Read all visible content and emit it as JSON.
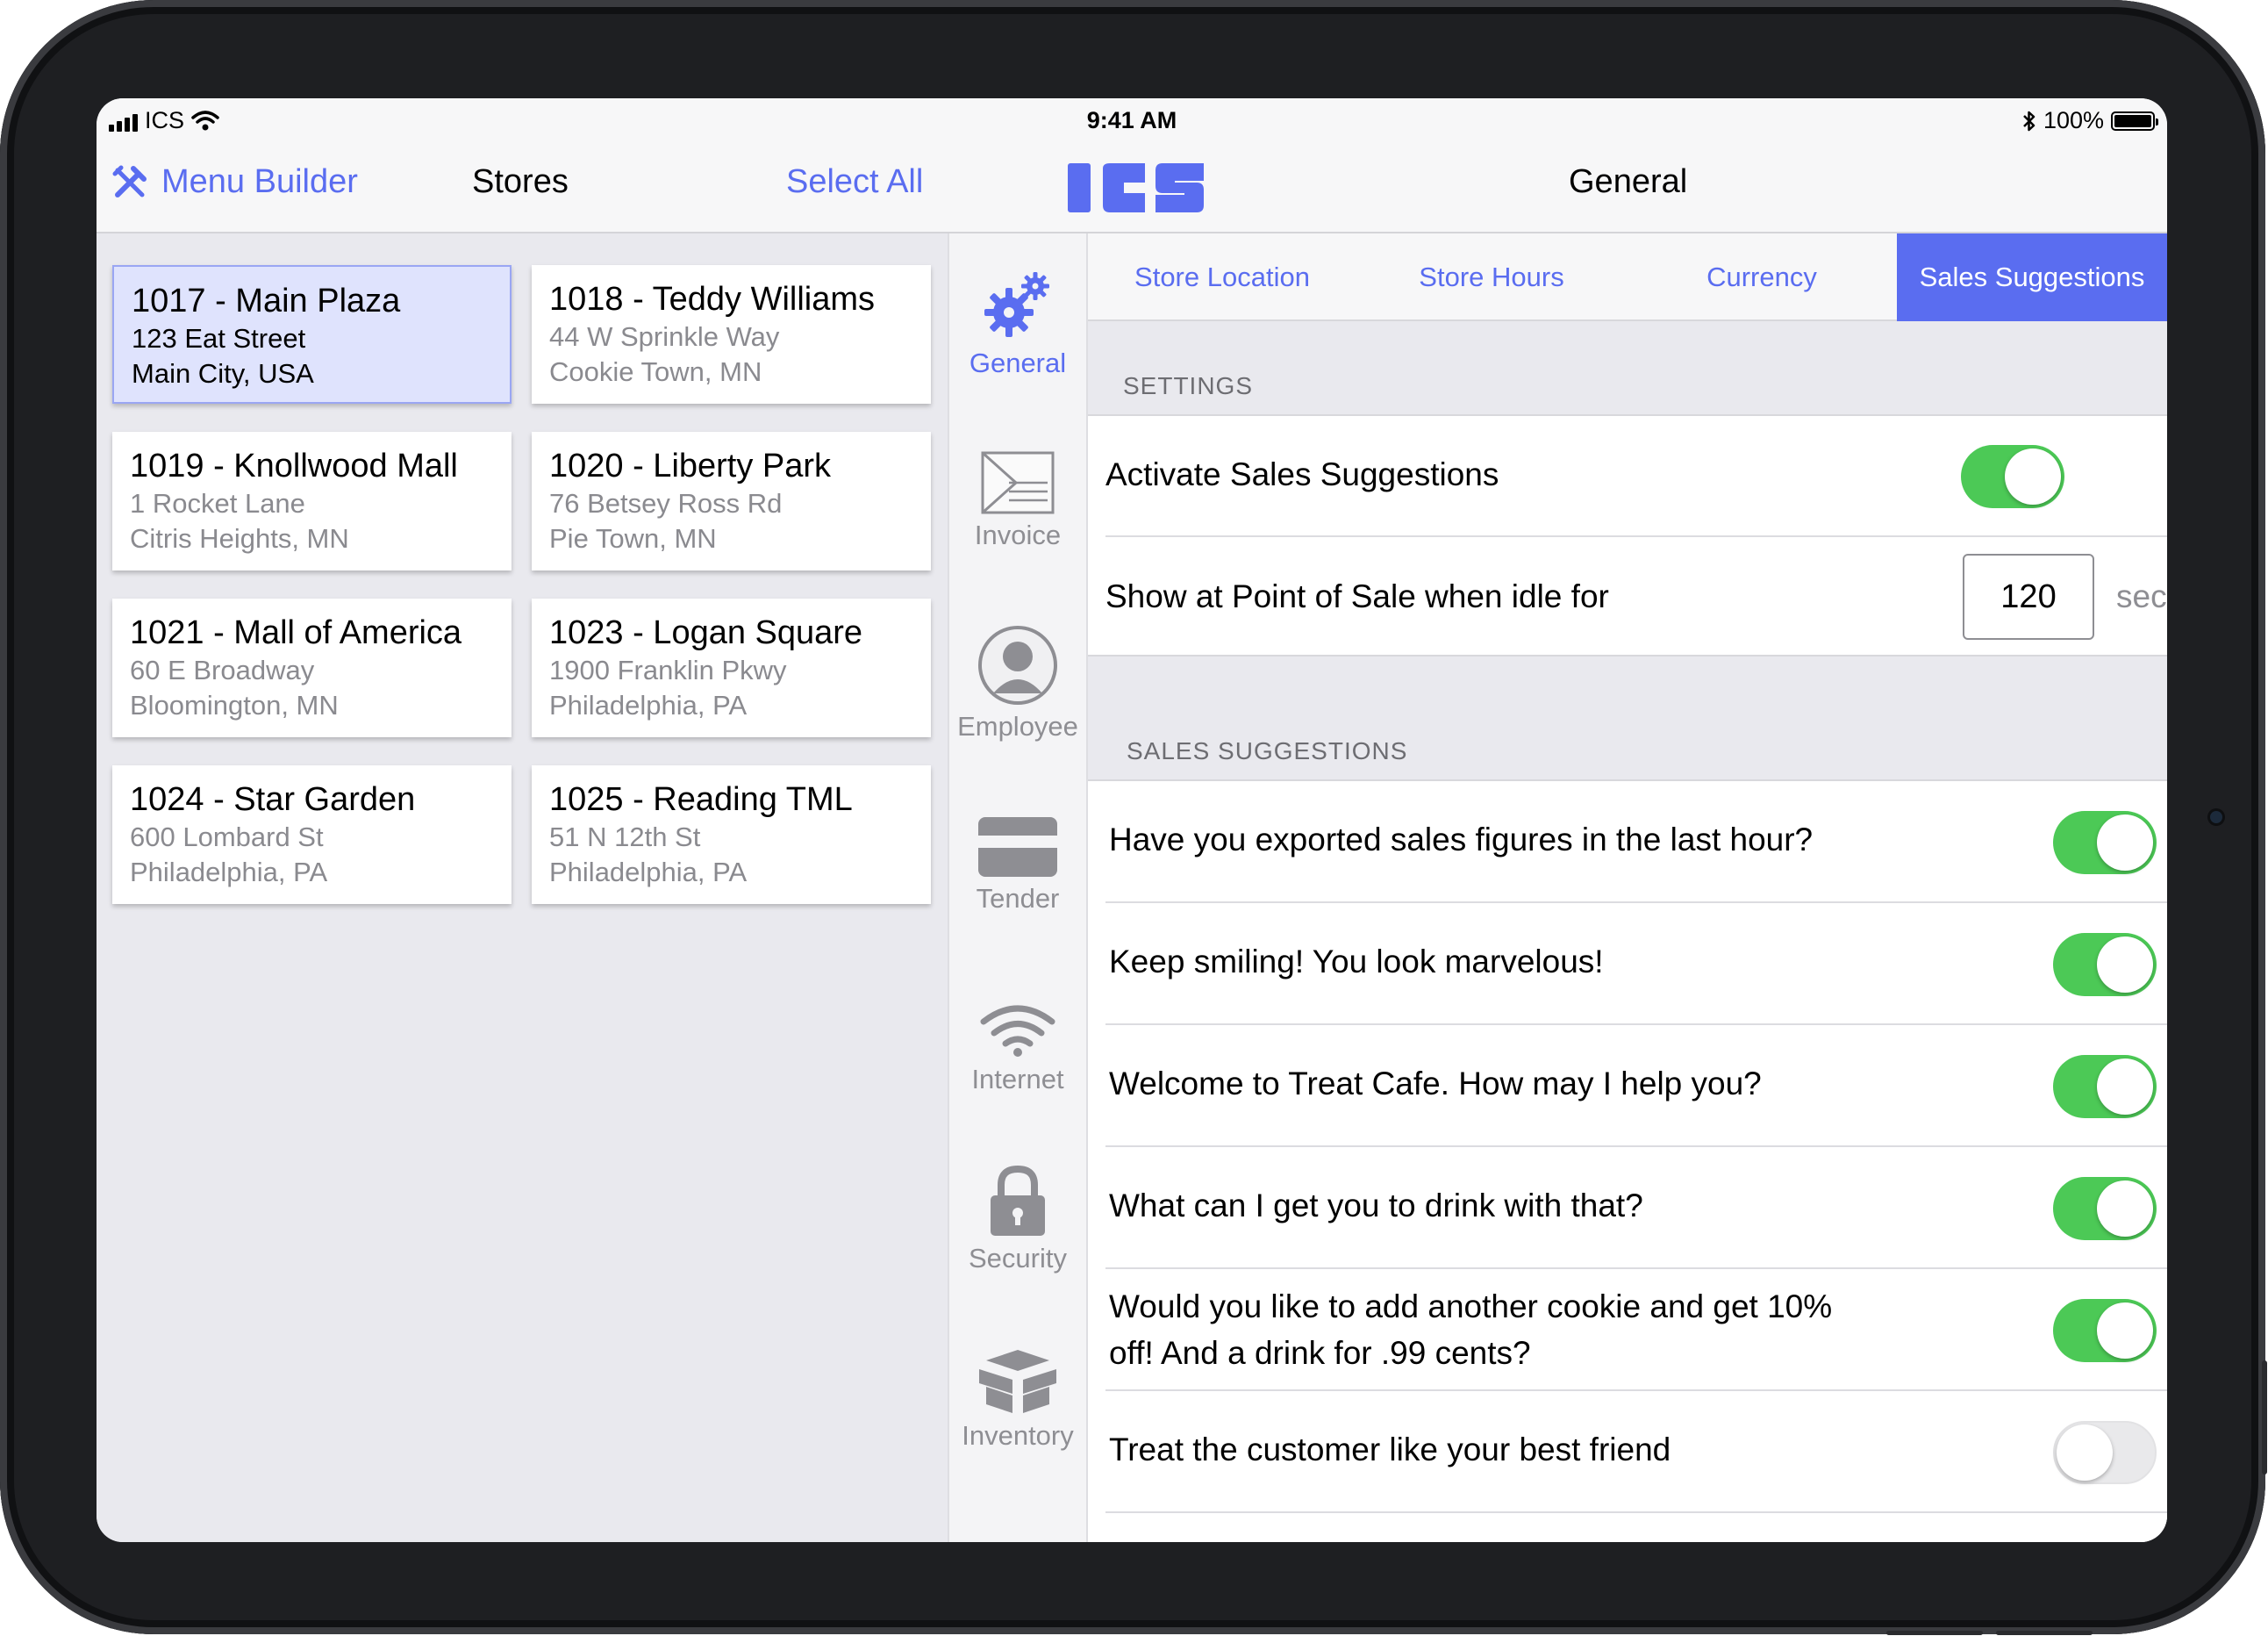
{
  "status_bar": {
    "carrier": "ICS",
    "time": "9:41 AM",
    "battery": "100%"
  },
  "nav": {
    "menu_builder": "Menu Builder",
    "stores_title": "Stores",
    "select_all": "Select All",
    "section_title": "General"
  },
  "stores": [
    {
      "name": "1017 - Main Plaza",
      "address1": "123 Eat Street",
      "address2": "Main City, USA",
      "selected": true
    },
    {
      "name": "1018 - Teddy Williams",
      "address1": "44 W Sprinkle Way",
      "address2": "Cookie Town, MN"
    },
    {
      "name": "1019 - Knollwood Mall",
      "address1": "1 Rocket Lane",
      "address2": "Citris Heights, MN"
    },
    {
      "name": "1020 - Liberty Park",
      "address1": "76 Betsey Ross Rd",
      "address2": "Pie Town, MN"
    },
    {
      "name": "1021 - Mall of America",
      "address1": "60 E Broadway",
      "address2": "Bloomington, MN"
    },
    {
      "name": "1023 - Logan Square",
      "address1": "1900 Franklin Pkwy",
      "address2": "Philadelphia, PA"
    },
    {
      "name": "1024 - Star Garden",
      "address1": "600 Lombard St",
      "address2": "Philadelphia, PA"
    },
    {
      "name": "1025 - Reading TML",
      "address1": "51 N 12th St",
      "address2": "Philadelphia, PA"
    }
  ],
  "sidebar": {
    "items": [
      {
        "label": "General",
        "icon": "gears-icon",
        "active": true
      },
      {
        "label": "Invoice",
        "icon": "invoice-icon"
      },
      {
        "label": "Employee",
        "icon": "person-icon"
      },
      {
        "label": "Tender",
        "icon": "credit-card-icon"
      },
      {
        "label": "Internet",
        "icon": "wifi-icon"
      },
      {
        "label": "Security",
        "icon": "lock-icon"
      },
      {
        "label": "Inventory",
        "icon": "boxes-icon"
      }
    ]
  },
  "tabs": [
    {
      "label": "Store Location"
    },
    {
      "label": "Store Hours"
    },
    {
      "label": "Currency"
    },
    {
      "label": "Sales Suggestions",
      "active": true
    }
  ],
  "settings": {
    "header": "SETTINGS",
    "activate_label": "Activate Sales Suggestions",
    "activate_on": true,
    "idle_label": "Show at Point of Sale when idle for",
    "idle_value": "120",
    "idle_unit": "seconds."
  },
  "suggestions": {
    "header": "SALES SUGGESTIONS",
    "items": [
      {
        "text": "Have you exported sales figures in the last hour?",
        "on": true
      },
      {
        "text": "Keep smiling! You look marvelous!",
        "on": true
      },
      {
        "text": "Welcome to Treat Cafe. How may I help you?",
        "on": true
      },
      {
        "text": "What can I get you to drink with that?",
        "on": true
      },
      {
        "text_line1": "Would you like to add another cookie and get 10%",
        "text_line2": "off! And a drink for .99 cents?",
        "on": true
      },
      {
        "text": "Treat the customer like your best friend",
        "on": false
      }
    ]
  },
  "colors": {
    "accent": "#5a6df0",
    "toggle_on": "#4cc956",
    "selected_card": "#dfe3fd"
  }
}
